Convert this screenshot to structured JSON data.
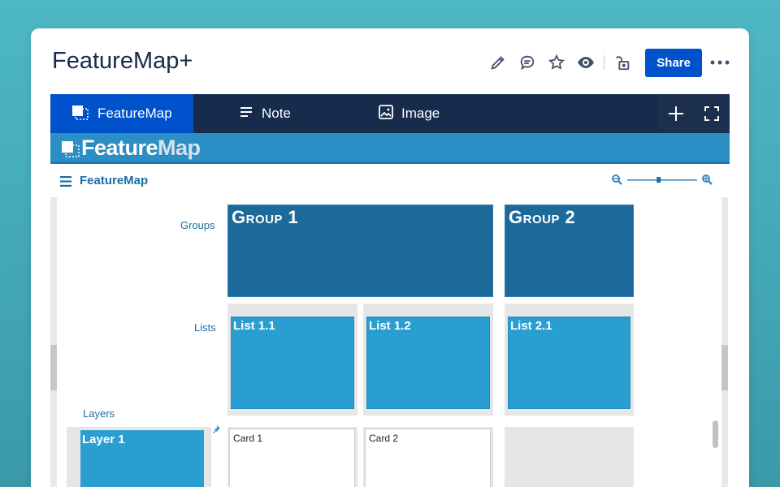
{
  "page": {
    "title": "FeatureMap+",
    "share_label": "Share"
  },
  "actions": {
    "icons": [
      "edit-icon",
      "comment-icon",
      "star-icon",
      "watch-icon",
      "restrictions-unlock-icon",
      "more-icon"
    ]
  },
  "tabs": [
    {
      "label": "FeatureMap",
      "icon": "featuremap-icon",
      "active": true
    },
    {
      "label": "Note",
      "icon": "note-icon",
      "active": false
    },
    {
      "label": "Image",
      "icon": "image-icon",
      "active": false
    }
  ],
  "tab_tools": [
    "add-icon",
    "fullscreen-icon"
  ],
  "banner": {
    "logo_part1": "Feature",
    "logo_part2": "Map"
  },
  "featuremap": {
    "title": "FeatureMap",
    "zoom_level": 0.45,
    "row_labels": {
      "groups": "Groups",
      "lists": "Lists",
      "layers": "Layers"
    },
    "groups": [
      {
        "title": "Group 1"
      },
      {
        "title": "Group 2"
      }
    ],
    "lists": [
      {
        "title": "List 1.1"
      },
      {
        "title": "List 1.2"
      },
      {
        "title": "List 2.1"
      }
    ],
    "layers": [
      {
        "title": "Layer 1"
      }
    ],
    "cards": [
      {
        "title": "Card 1"
      },
      {
        "title": "Card 2"
      }
    ]
  },
  "colors": {
    "primary": "#0052cc",
    "navy": "#172b4d",
    "banner": "#2b8fc5",
    "group": "#1b6a9a",
    "list": "#2a9ed0"
  }
}
